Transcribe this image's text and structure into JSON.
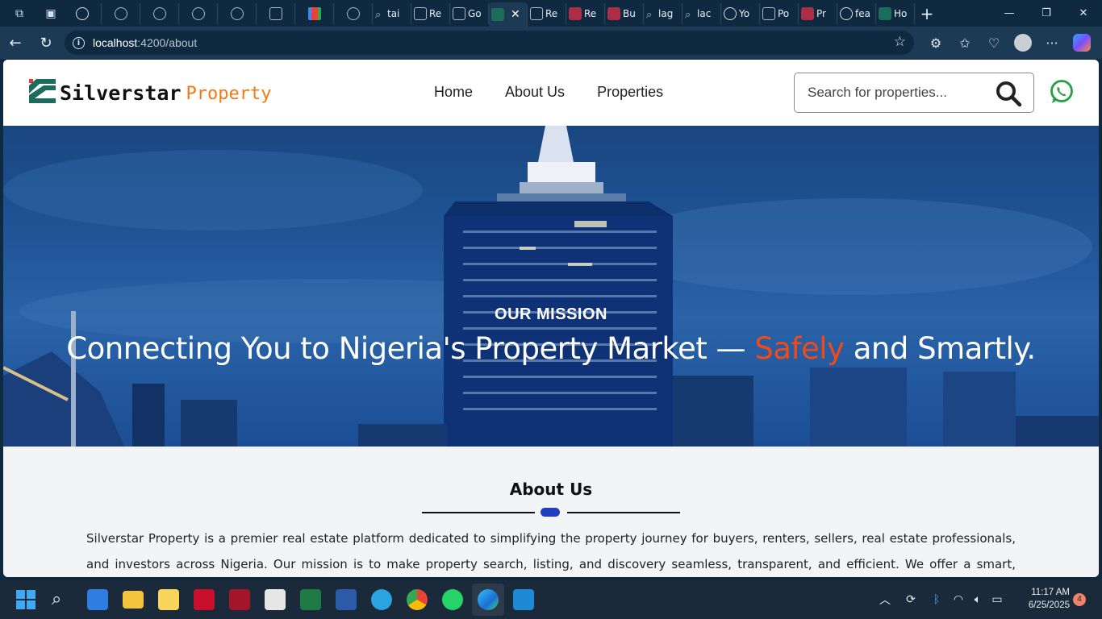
{
  "browser": {
    "tabs": [
      {
        "label": "",
        "icon": "github-icon"
      },
      {
        "label": "",
        "icon": "globe-icon"
      },
      {
        "label": "",
        "icon": "globe-icon"
      },
      {
        "label": "",
        "icon": "globe-icon"
      },
      {
        "label": "",
        "icon": "globe-icon"
      },
      {
        "label": "",
        "icon": "app-icon"
      },
      {
        "label": "",
        "icon": "gmail-icon"
      },
      {
        "label": "",
        "icon": "globe-icon"
      },
      {
        "label": "tai",
        "icon": "search-icon"
      },
      {
        "label": "Re",
        "icon": "app-icon"
      },
      {
        "label": "Go",
        "icon": "app-icon"
      },
      {
        "label": "",
        "icon": "silverstar-icon",
        "active": true
      },
      {
        "label": "Re",
        "icon": "app-icon"
      },
      {
        "label": "Re",
        "icon": "house-icon"
      },
      {
        "label": "Bu",
        "icon": "house-icon"
      },
      {
        "label": "lag",
        "icon": "search-icon"
      },
      {
        "label": "lac",
        "icon": "search-icon"
      },
      {
        "label": "Yo",
        "icon": "github-icon"
      },
      {
        "label": "Po",
        "icon": "app-icon"
      },
      {
        "label": "Pr",
        "icon": "house-icon"
      },
      {
        "label": "fea",
        "icon": "github-icon"
      },
      {
        "label": "Ho",
        "icon": "silverstar-icon"
      }
    ],
    "url_host": "localhost",
    "url_path": ":4200/about"
  },
  "site": {
    "logo_name": "Silverstar",
    "logo_sub": "Property",
    "nav": [
      "Home",
      "About Us",
      "Properties"
    ],
    "search_placeholder": "Search for properties..."
  },
  "hero": {
    "kicker": "OUR MISSION",
    "title_before": "Connecting You to Nigeria's Property Market — ",
    "title_accent": "Safely",
    "title_after": " and Smartly."
  },
  "about": {
    "heading": "About Us",
    "body": "Silverstar Property is a premier real estate platform dedicated to simplifying the property journey for buyers, renters, sellers, real estate professionals, and investors across Nigeria. Our mission is to make property search, listing, and discovery seamless, transparent, and efficient. We offer a smart, intuitive, and user-friendly"
  },
  "taskbar": {
    "time": "11:17 AM",
    "date": "6/25/2025",
    "notification_count": "4"
  },
  "colors": {
    "accent_orange": "#f07a14",
    "accent_red": "#f04a1c",
    "whatsapp_green": "#25a244",
    "divider_blue": "#1f3fbf"
  }
}
